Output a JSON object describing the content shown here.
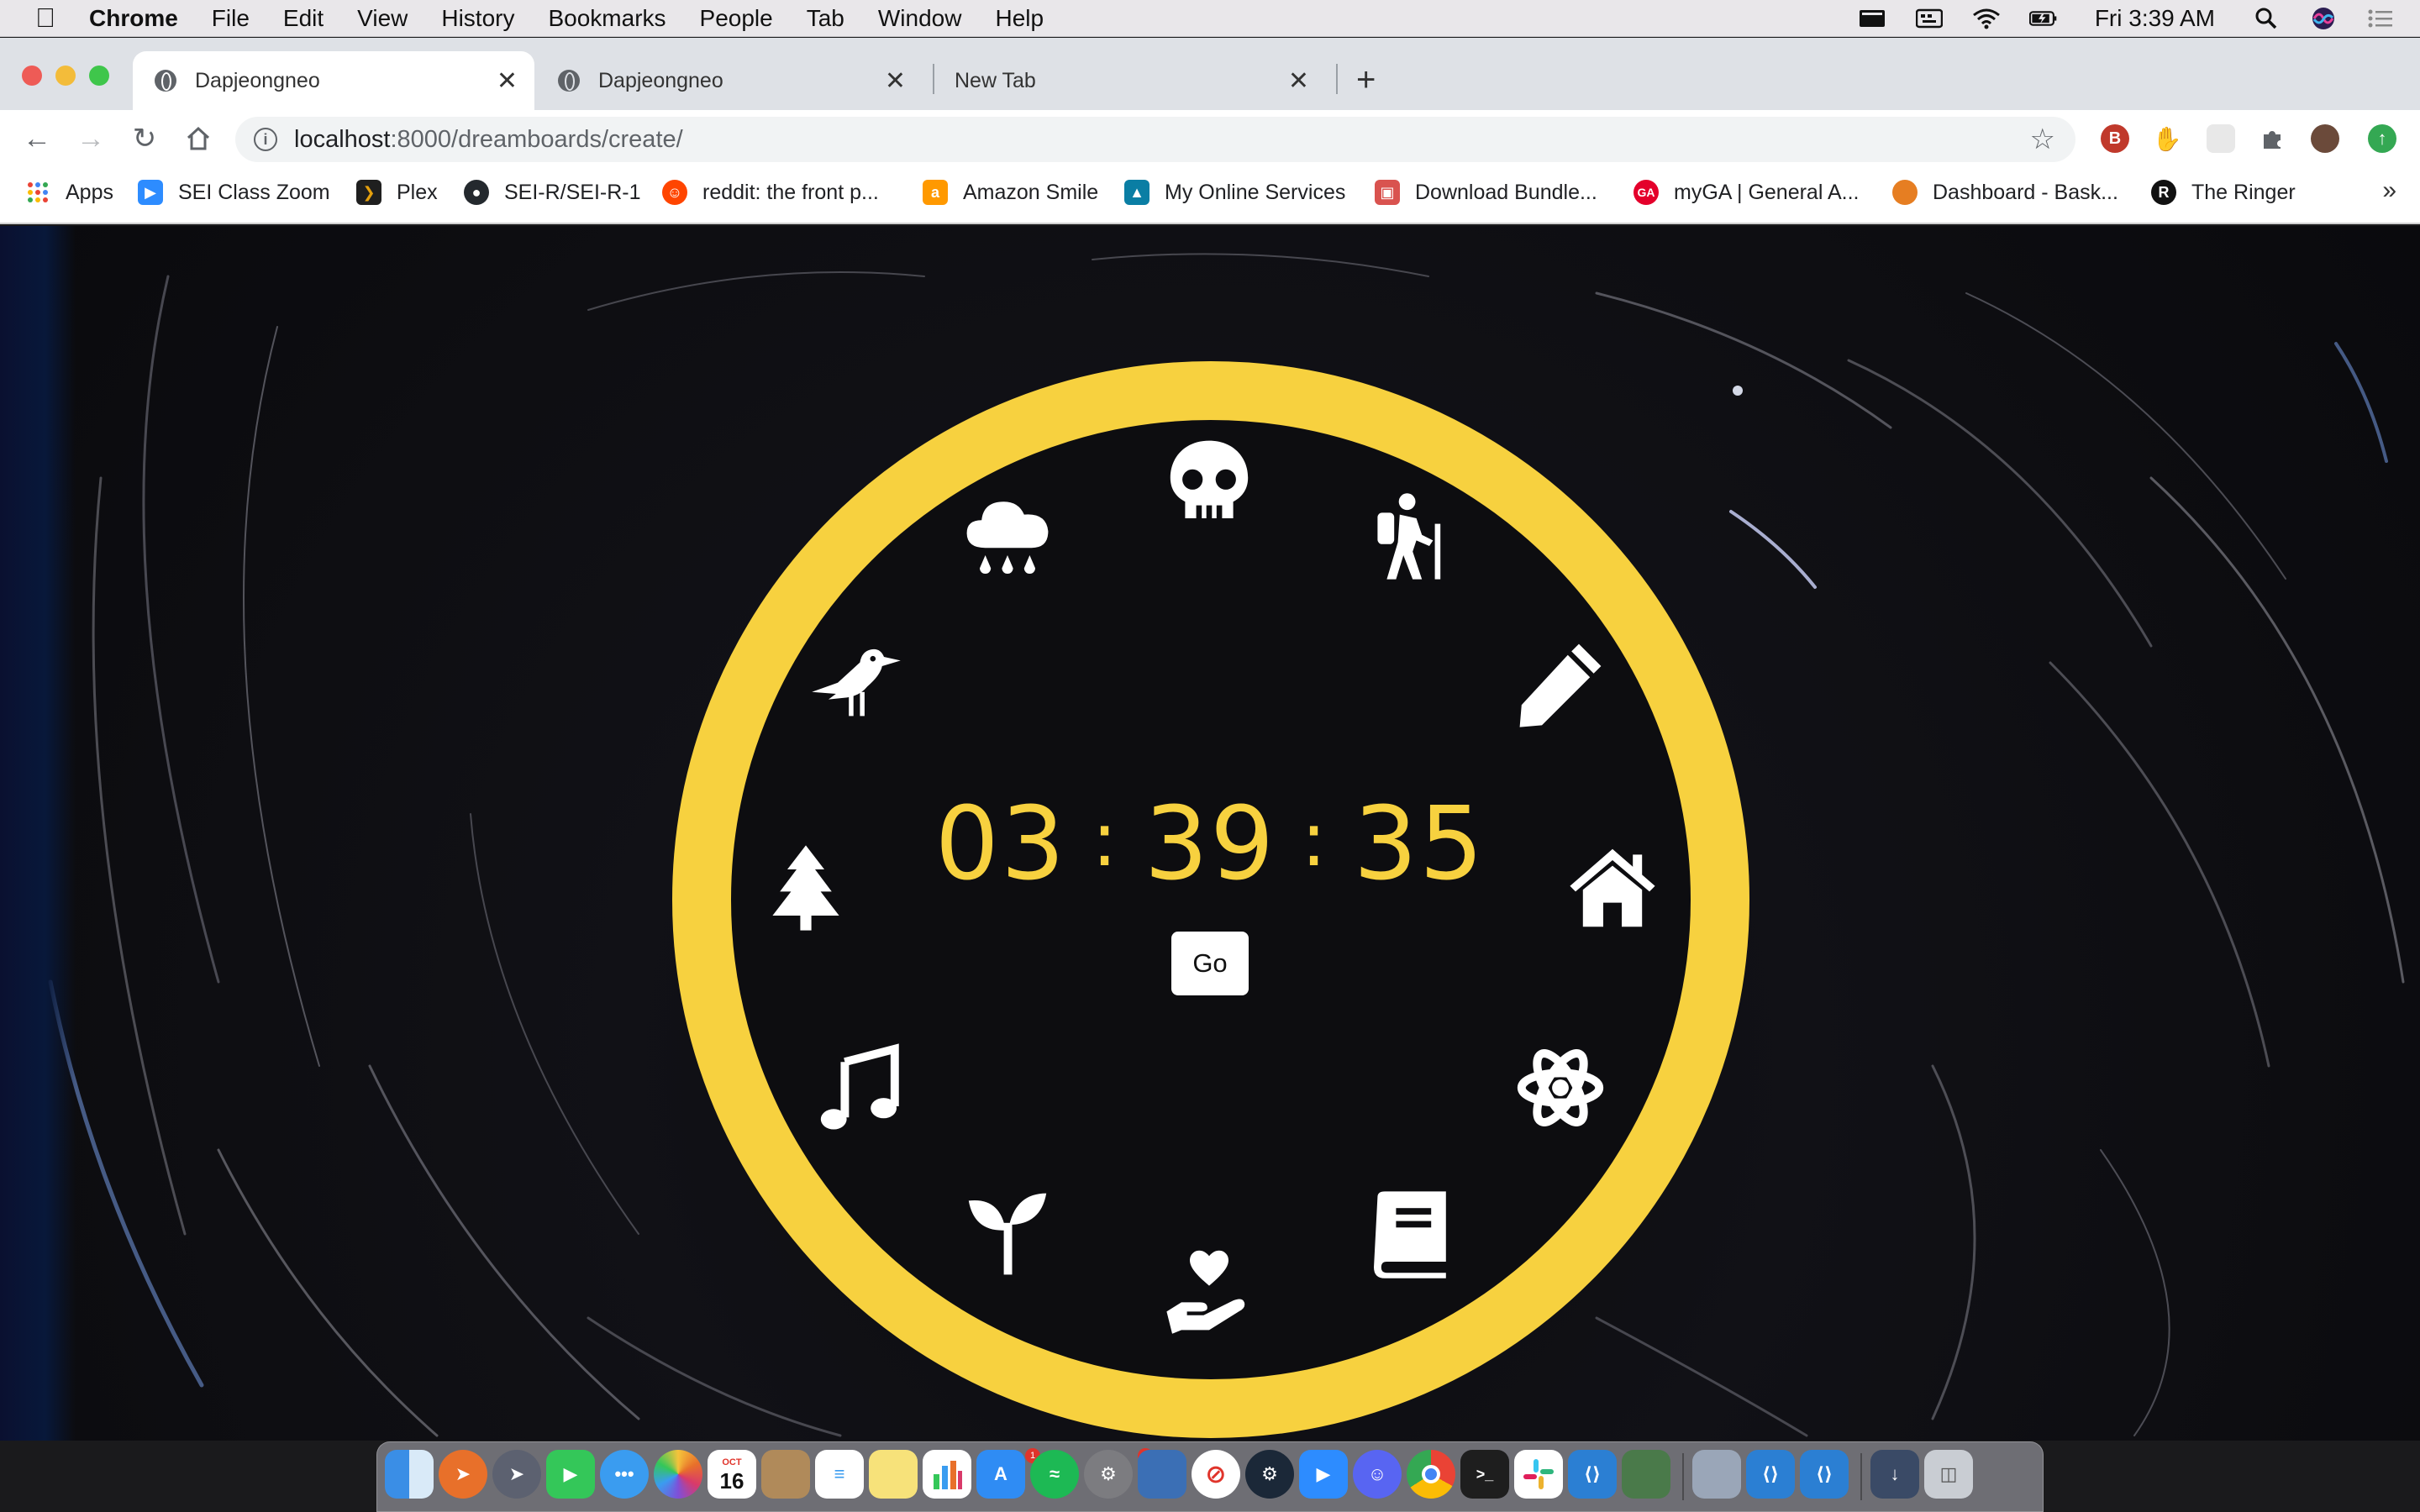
{
  "menubar": {
    "app_name": "Chrome",
    "items": [
      "File",
      "Edit",
      "View",
      "History",
      "Bookmarks",
      "People",
      "Tab",
      "Window",
      "Help"
    ],
    "clock": "Fri 3:39 AM"
  },
  "tabs": [
    {
      "title": "Dapjeongneo",
      "active": true
    },
    {
      "title": "Dapjeongneo",
      "active": false
    },
    {
      "title": "New Tab",
      "active": false
    }
  ],
  "address_bar": {
    "host": "localhost",
    "path": ":8000/dreamboards/create/"
  },
  "bookmarks": [
    {
      "label": "Apps",
      "icon": "apps-grid-icon",
      "color": "#ea4335"
    },
    {
      "label": "SEI Class Zoom",
      "icon": "zoom-icon",
      "color": "#2d8cff"
    },
    {
      "label": "Plex",
      "icon": "plex-icon",
      "color": "#1f1f1f"
    },
    {
      "label": "SEI-R/SEI-R-1",
      "icon": "github-icon",
      "color": "#24292e"
    },
    {
      "label": "reddit: the front p...",
      "icon": "reddit-icon",
      "color": "#ff4500"
    },
    {
      "label": "Amazon Smile",
      "icon": "amazon-icon",
      "color": "#ff9900"
    },
    {
      "label": "My Online Services",
      "icon": "services-icon",
      "color": "#0a7ea4"
    },
    {
      "label": "Download Bundle...",
      "icon": "bundle-icon",
      "color": "#d9534f"
    },
    {
      "label": "myGA | General A...",
      "icon": "ga-icon",
      "color": "#e4002b"
    },
    {
      "label": "Dashboard - Bask...",
      "icon": "basketball-icon",
      "color": "#e67e22"
    },
    {
      "label": "The Ringer",
      "icon": "ringer-icon",
      "color": "#111111"
    }
  ],
  "bookmarks_more": "»",
  "dial": {
    "accent_color": "#f7d13f",
    "time": {
      "hours": "03",
      "minutes": "39",
      "seconds": "35",
      "separator": ":"
    },
    "go_label": "Go",
    "icons": [
      "skull-icon",
      "hiking-icon",
      "pencil-icon",
      "home-icon",
      "atom-icon",
      "book-icon",
      "hand-holding-heart-icon",
      "seedling-icon",
      "music-icon",
      "tree-icon",
      "crow-icon",
      "cloud-rain-icon"
    ]
  },
  "dock": {
    "apps": [
      "Finder",
      "Safari",
      "Launchpad",
      "FaceTime",
      "Messages",
      "Photos",
      "Calendar",
      "Contacts",
      "Reminders",
      "Notes",
      "Numbers",
      "App Store",
      "Spotify",
      "System Preferences",
      "Preview",
      "News",
      "Steam",
      "Zoom",
      "Discord",
      "Chrome",
      "Terminal",
      "Slack",
      "VS Code",
      "Photo Booth",
      "Image Capture",
      "VS Code Insiders",
      "VS Code 2",
      "Downloads",
      "Trash"
    ],
    "calendar_month": "OCT",
    "calendar_day": "16"
  }
}
